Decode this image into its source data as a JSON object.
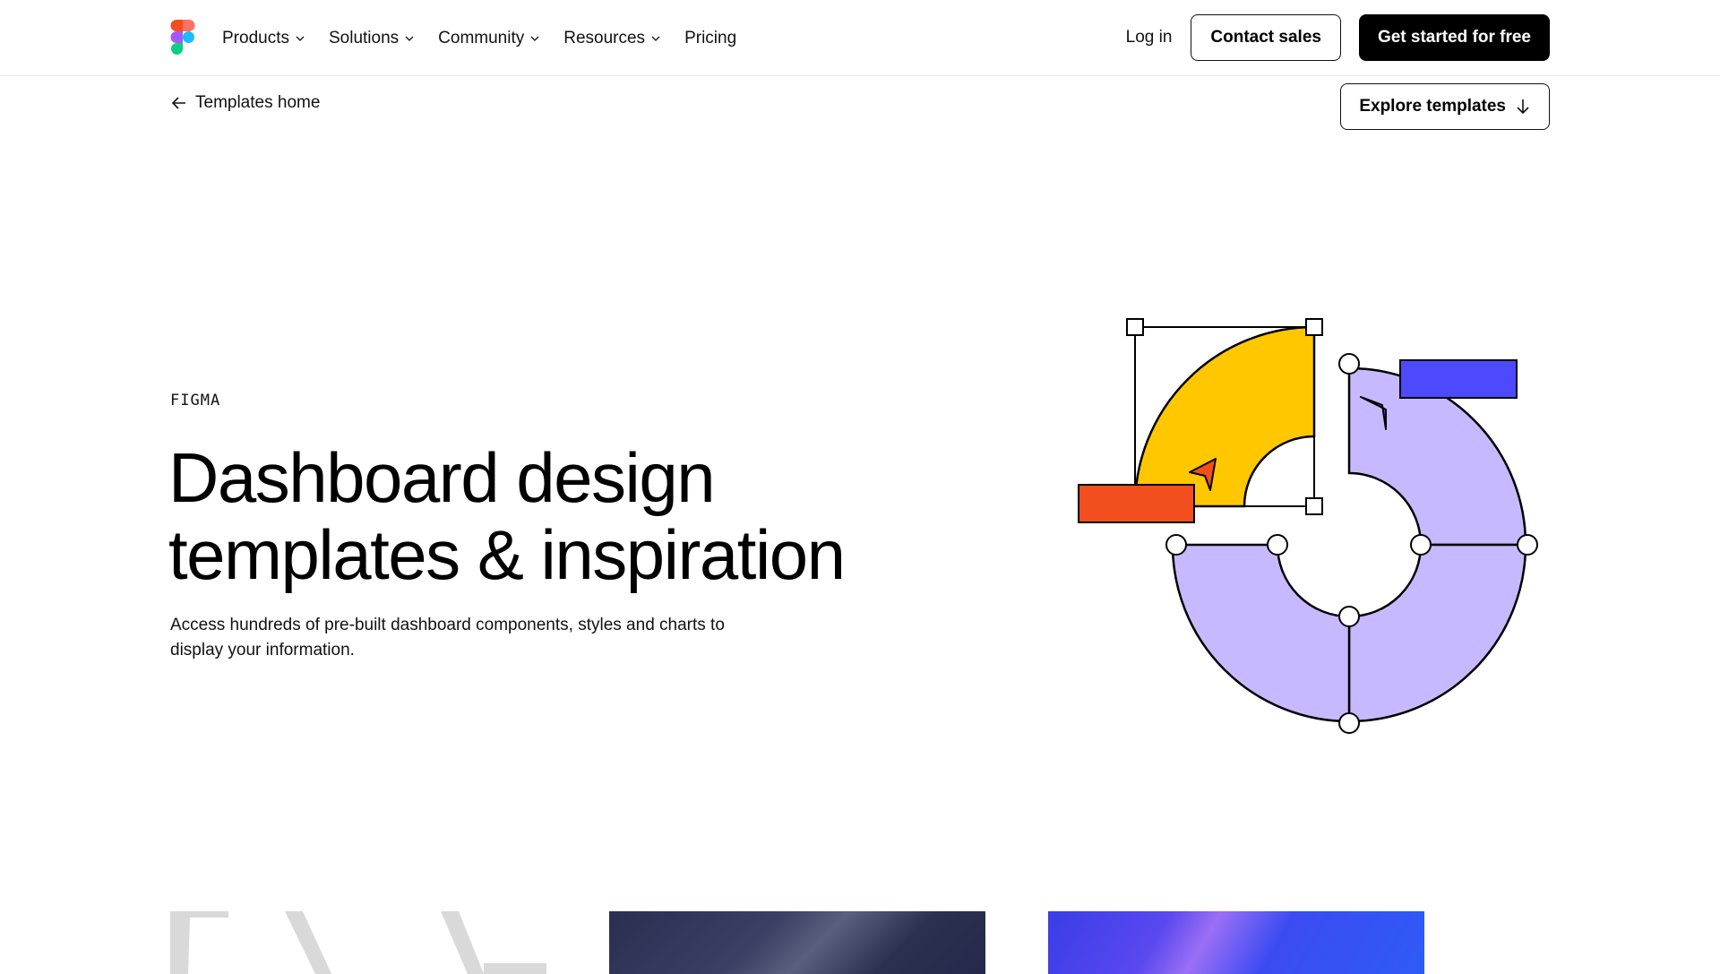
{
  "nav": {
    "items": [
      {
        "label": "Products"
      },
      {
        "label": "Solutions"
      },
      {
        "label": "Community"
      },
      {
        "label": "Resources"
      },
      {
        "label": "Pricing"
      }
    ],
    "login_label": "Log in",
    "contact_label": "Contact sales",
    "cta_label": "Get started for free"
  },
  "subheader": {
    "back_label": "Templates home",
    "explore_label": "Explore templates"
  },
  "hero": {
    "eyebrow": "FIGMA",
    "title_line1": "Dashboard design",
    "title_line2": "templates & inspiration",
    "subtitle_line1": "Access hundreds of pre-built dashboard components, styles and charts to",
    "subtitle_line2": "display your information."
  },
  "colors": {
    "yellow": "#ffc700",
    "orange": "#f24e1e",
    "lavender": "#c7b9ff",
    "blue": "#4d49fc",
    "black": "#000000",
    "white": "#ffffff"
  },
  "icons": {
    "logo": "figma-logo",
    "chevron": "chevron-down-icon",
    "back": "arrow-left-icon",
    "explore": "arrow-down-icon"
  }
}
